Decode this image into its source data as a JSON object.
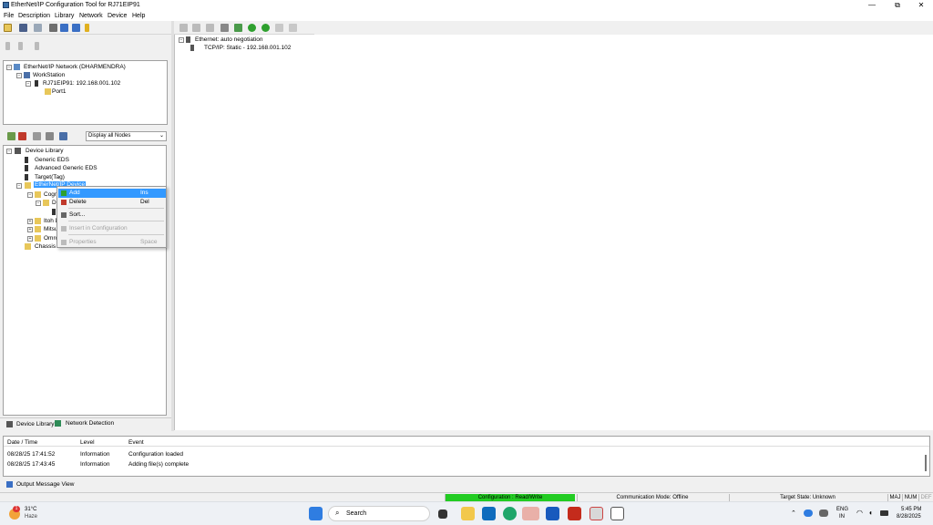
{
  "window": {
    "title": "EtherNet/IP Configuration Tool for RJ71EIP91",
    "controls": [
      "—",
      "⧉",
      "✕"
    ]
  },
  "menu": [
    "File",
    "Description",
    "Library",
    "Network",
    "Device",
    "Help"
  ],
  "network_tree": {
    "root": "EtherNet/IP Network (DHARMENDRA)",
    "workstation": "WorkStation",
    "module": "RJ71EIP91: 192.168.001.102",
    "port": "Port1"
  },
  "library_toolbar": {
    "filter_value": "Display all Nodes"
  },
  "device_library": {
    "root": "Device Library",
    "items": [
      "Generic EDS",
      "Advanced Generic EDS",
      "Target(Tag)",
      "EtherNet/IP Device"
    ],
    "sub_items": [
      "Cogn",
      "D",
      "Itoh D",
      "Mitsu",
      "Omro",
      "Chassis a"
    ]
  },
  "context_menu": {
    "items": [
      {
        "label": "Add",
        "shortcut": "Ins",
        "enabled": true,
        "highlighted": true
      },
      {
        "label": "Delete",
        "shortcut": "Del",
        "enabled": true
      },
      {
        "label": "Sort...",
        "shortcut": "",
        "enabled": true
      },
      {
        "label": "Insert in Configuration",
        "shortcut": "",
        "enabled": false
      },
      {
        "label": "Properties",
        "shortcut": "Space",
        "enabled": false
      }
    ]
  },
  "left_tabs": [
    "Device Library",
    "Network Detection"
  ],
  "config_tree": {
    "ethernet": "Ethernet: auto negotiation",
    "tcpip": "TCP/IP: Static - 192.168.001.102"
  },
  "output": {
    "headers": [
      "Date / Time",
      "Level",
      "Event"
    ],
    "rows": [
      [
        "08/28/25 17:41:52",
        "Information",
        "Configuration loaded"
      ],
      [
        "08/28/25 17:43:45",
        "Information",
        "Adding file(s) complete"
      ]
    ],
    "tab": "Output Message View"
  },
  "status": {
    "configuration": "Configuration : Read/Write",
    "comm_mode": "Communication Mode:  Offline",
    "target_state": "Target State:   Unknown",
    "keys": [
      "MAJ",
      "NUM",
      "DEF"
    ]
  },
  "taskbar": {
    "weather_temp": "31°C",
    "weather_desc": "Haze",
    "weather_badge": "1",
    "search_label": "Search",
    "lang1": "ENG",
    "lang2": "IN",
    "time": "5:45 PM",
    "date": "8/28/2025"
  },
  "colors": {
    "highlight": "#3399ff",
    "status_green": "#22cc22"
  }
}
